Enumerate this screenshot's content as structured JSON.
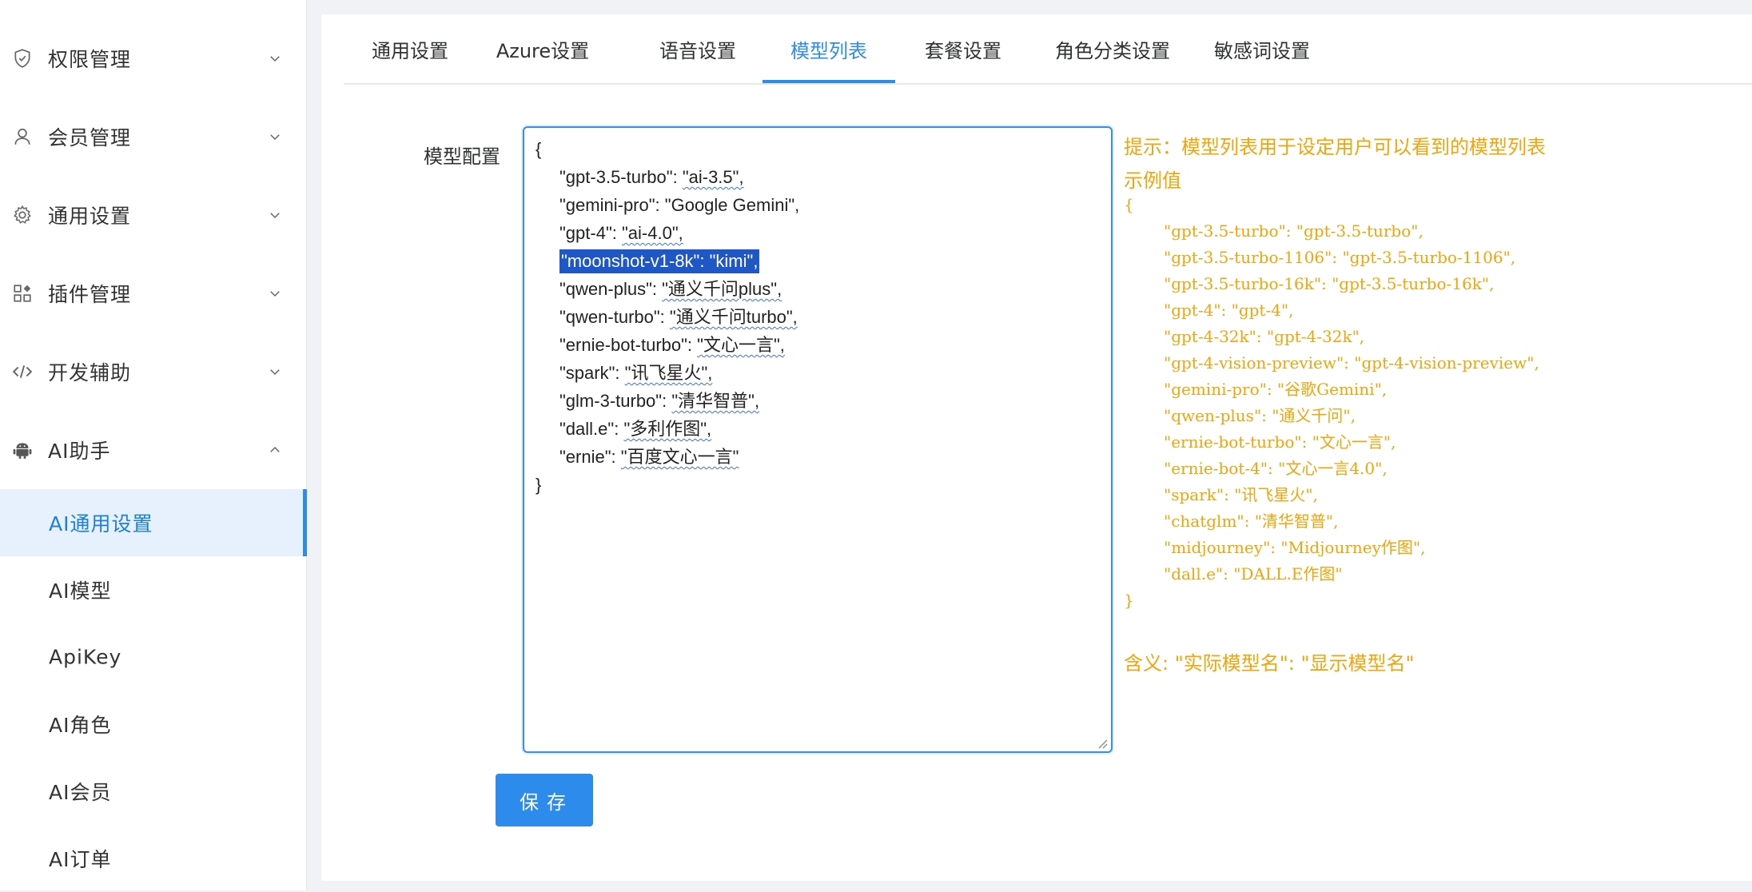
{
  "colors": {
    "accent": "#2d8ceb",
    "active_bg": "#e6f1fd",
    "hint": "#f2a40a",
    "selection": "#1f57c7"
  },
  "sidebar": {
    "groups": [
      {
        "label": "权限管理",
        "icon": "shield-icon",
        "expanded": false
      },
      {
        "label": "会员管理",
        "icon": "user-icon",
        "expanded": false
      },
      {
        "label": "通用设置",
        "icon": "gear-icon",
        "expanded": false
      },
      {
        "label": "插件管理",
        "icon": "apps-icon",
        "expanded": false
      },
      {
        "label": "开发辅助",
        "icon": "code-icon",
        "expanded": false
      },
      {
        "label": "AI助手",
        "icon": "android-icon",
        "expanded": true
      }
    ],
    "ai_items": [
      {
        "label": "AI通用设置",
        "active": true
      },
      {
        "label": "AI模型",
        "active": false
      },
      {
        "label": "ApiKey",
        "active": false
      },
      {
        "label": "AI角色",
        "active": false
      },
      {
        "label": "AI会员",
        "active": false
      },
      {
        "label": "AI订单",
        "active": false
      }
    ]
  },
  "tabs": [
    {
      "label": "通用设置",
      "active": false
    },
    {
      "label": "Azure设置",
      "active": false
    },
    {
      "label": "语音设置",
      "active": false
    },
    {
      "label": "模型列表",
      "active": true
    },
    {
      "label": "套餐设置",
      "active": false
    },
    {
      "label": "角色分类设置",
      "active": false
    },
    {
      "label": "敏感词设置",
      "active": false
    }
  ],
  "form": {
    "label": "模型配置",
    "code": {
      "open": "{",
      "close": "}",
      "lines": [
        {
          "key": "\"gpt-3.5-turbo\": ",
          "value": "\"ai-3.5\","
        },
        {
          "key": "\"gemini-pro\": ",
          "value": "\"Google Gemini\","
        },
        {
          "key": "\"gpt-4\": ",
          "value": "\"ai-4.0\","
        },
        {
          "key": "\"moonshot-v1-8k\": ",
          "value": "\"kimi\","
        },
        {
          "key": "\"qwen-plus\": ",
          "value": "\"通义千问plus\","
        },
        {
          "key": "\"qwen-turbo\": ",
          "value": "\"通义千问turbo\","
        },
        {
          "key": "\"ernie-bot-turbo\": ",
          "value": "\"文心一言\","
        },
        {
          "key": "\"spark\": ",
          "value": "\"讯飞星火\","
        },
        {
          "key": "\"glm-3-turbo\": ",
          "value": "\"清华智普\","
        },
        {
          "key": "\"dall.e\": ",
          "value": "\"多利作图\","
        },
        {
          "key": "\"ernie\": ",
          "value": "\"百度文心一言\""
        }
      ]
    }
  },
  "hint": {
    "title": "提示：模型列表用于设定用户可以看到的模型列表",
    "subtitle": "示例值",
    "example_open": "{",
    "example_close": "}",
    "example_lines": [
      "\"gpt-3.5-turbo\": \"gpt-3.5-turbo\",",
      "\"gpt-3.5-turbo-1106\": \"gpt-3.5-turbo-1106\",",
      "\"gpt-3.5-turbo-16k\": \"gpt-3.5-turbo-16k\",",
      "\"gpt-4\": \"gpt-4\",",
      "\"gpt-4-32k\": \"gpt-4-32k\",",
      "\"gpt-4-vision-preview\": \"gpt-4-vision-preview\",",
      "\"gemini-pro\": \"谷歌Gemini\",",
      "\"qwen-plus\": \"通义千问\",",
      "\"ernie-bot-turbo\": \"文心一言\",",
      "\"ernie-bot-4\": \"文心一言4.0\",",
      "\"spark\": \"讯飞星火\",",
      "\"chatglm\": \"清华智普\",",
      "\"midjourney\": \"Midjourney作图\",",
      "\"dall.e\": \"DALL.E作图\""
    ],
    "meaning": "含义: \"实际模型名\": \"显示模型名\""
  },
  "save_button": {
    "label": "保存"
  }
}
